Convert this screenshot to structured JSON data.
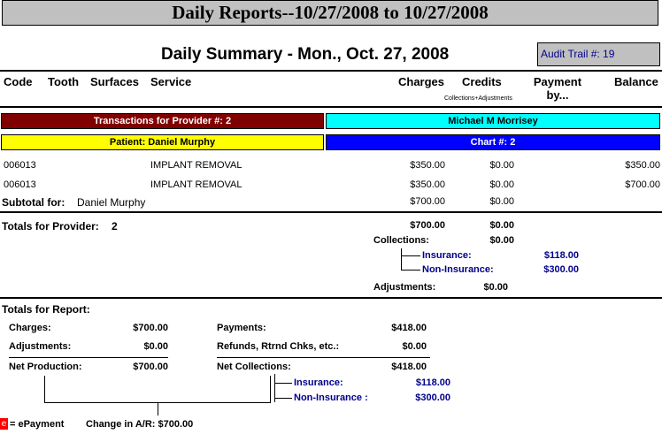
{
  "window": {
    "title": "Daily Reports--10/27/2008 to 10/27/2008"
  },
  "summary": {
    "heading": "Daily Summary -  Mon., Oct. 27, 2008",
    "audit_trail": "Audit Trail #: 19"
  },
  "columns": {
    "code": "Code",
    "tooth": "Tooth",
    "surfaces": "Surfaces",
    "service": "Service",
    "charges": "Charges",
    "credits": "Credits",
    "credits_sub": "Collections+Adjustments",
    "payment_by": "Payment by...",
    "balance": "Balance"
  },
  "provider_bar": {
    "label": "Transactions for Provider #: 2",
    "name": "Michael M Morrisey"
  },
  "patient_bar": {
    "label": "Patient: Daniel Murphy",
    "chart": "Chart #: 2"
  },
  "transactions": [
    {
      "code": "006013",
      "service": "IMPLANT REMOVAL",
      "charges": "$350.00",
      "credits": "$0.00",
      "balance": "$350.00"
    },
    {
      "code": "006013",
      "service": "IMPLANT REMOVAL",
      "charges": "$350.00",
      "credits": "$0.00",
      "balance": "$700.00"
    }
  ],
  "subtotal": {
    "label": "Subtotal for:",
    "name": "Daniel Murphy",
    "charges": "$700.00",
    "credits": "$0.00"
  },
  "provider_totals": {
    "label": "Totals for Provider:",
    "provider": "2",
    "charges": "$700.00",
    "credits": "$0.00",
    "collections_label": "Collections:",
    "collections": "$0.00",
    "insurance_label": "Insurance:",
    "insurance": "$118.00",
    "non_insurance_label": "Non-Insurance:",
    "non_insurance": "$300.00",
    "adjustments_label": "Adjustments:",
    "adjustments": "$0.00"
  },
  "report_totals": {
    "label": "Totals for Report:",
    "charges_label": "Charges:",
    "charges": "$700.00",
    "adjustments_label": "Adjustments:",
    "adjustments": "$0.00",
    "net_production_label": "Net Production:",
    "net_production": "$700.00",
    "payments_label": "Payments:",
    "payments": "$418.00",
    "refunds_label": "Refunds, Rtrnd Chks, etc.:",
    "refunds": "$0.00",
    "net_collections_label": "Net Collections:",
    "net_collections": "$418.00",
    "insurance_label": "Insurance:",
    "insurance": "$118.00",
    "non_insurance_label": "Non-Insurance :",
    "non_insurance": "$300.00"
  },
  "footer": {
    "epay_icon": "e",
    "epay_label": "= ePayment",
    "change_ar": "Change in A/R: $700.00"
  },
  "colors": {
    "provider_bg": "#800000",
    "cyan": "#00ffff",
    "yellow": "#ffff00",
    "blue": "#0000ff",
    "navy": "#00008b",
    "epay_red": "#ff0000"
  }
}
